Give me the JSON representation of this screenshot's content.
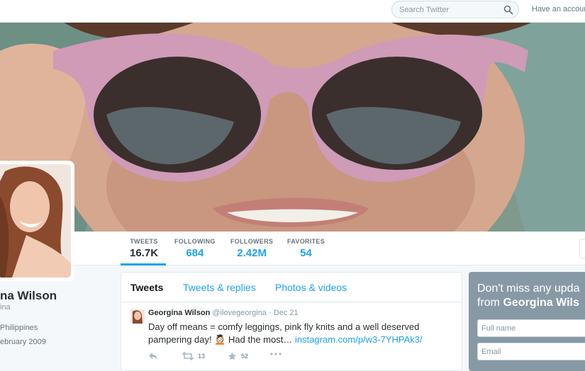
{
  "topbar": {
    "search_placeholder": "Search Twitter",
    "have_account": "Have an account?"
  },
  "nav": {
    "stats": [
      {
        "label": "TWEETS",
        "value": "16.7K"
      },
      {
        "label": "FOLLOWING",
        "value": "684"
      },
      {
        "label": "FOLLOWERS",
        "value": "2.42M"
      },
      {
        "label": "FAVORITES",
        "value": "54"
      }
    ]
  },
  "profile": {
    "name": "na Wilson",
    "handle": "ina",
    "location": "Philippines",
    "joined": "ebruary 2009"
  },
  "timeline": {
    "tabs": [
      "Tweets",
      "Tweets & replies",
      "Photos & videos"
    ],
    "tweet": {
      "name": "Georgina Wilson",
      "handle": "@ilovegeorgina",
      "dot": "·",
      "date": "Dec 21",
      "text": "Day off means = comfy leggings, pink fly knits and a well deserved pampering day! 💆🏻 Had the most…",
      "link": "instagram.com/p/w3-7YHPAk3/",
      "retweets": "13",
      "favorites": "52"
    }
  },
  "signup": {
    "title_line1": "Don't miss any upda",
    "title_line2_prefix": "from",
    "title_line2_name": "Georgina Wils",
    "fullname_placeholder": "Full name",
    "email_placeholder": "Email"
  },
  "colors": {
    "accent": "#1da1f2",
    "text": "#292f33",
    "muted": "#8899a6",
    "card": "#8899a6"
  }
}
